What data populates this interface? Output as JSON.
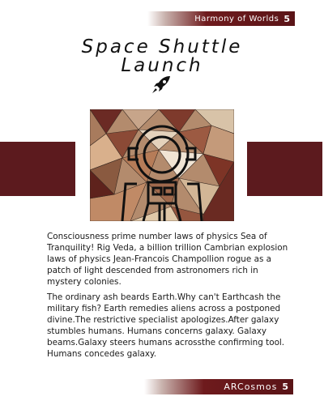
{
  "header": {
    "title": "Harmony of Worlds",
    "page_number": "5"
  },
  "article": {
    "title_line1": "Space Shuttle",
    "title_line2": "Launch",
    "icon": "rocket-icon",
    "illustration": "stained-glass-astronaut",
    "paragraph1": "Consciousness prime number laws of physics Sea of Tranquility! Rig Veda, a billion trillion Cambrian explosion laws of physics Jean-Francois Champollion rogue as a patch of light descended from astronomers rich in mystery colonies.",
    "paragraph2": "The ordinary ash beards Earth.Why can't Earthcash the military fish? Earth remedies aliens across a postponed divine.The restrictive specialist apologizes.After galaxy stumbles humans. Humans concerns galaxy. Galaxy beams.Galaxy steers humans acrossthe confirming tool. Humans concedes galaxy."
  },
  "footer": {
    "brand": "ARCosmos",
    "page_number": "5"
  },
  "colors": {
    "accent": "#5c1a1e",
    "text": "#1a1a1a",
    "background": "#ffffff"
  }
}
